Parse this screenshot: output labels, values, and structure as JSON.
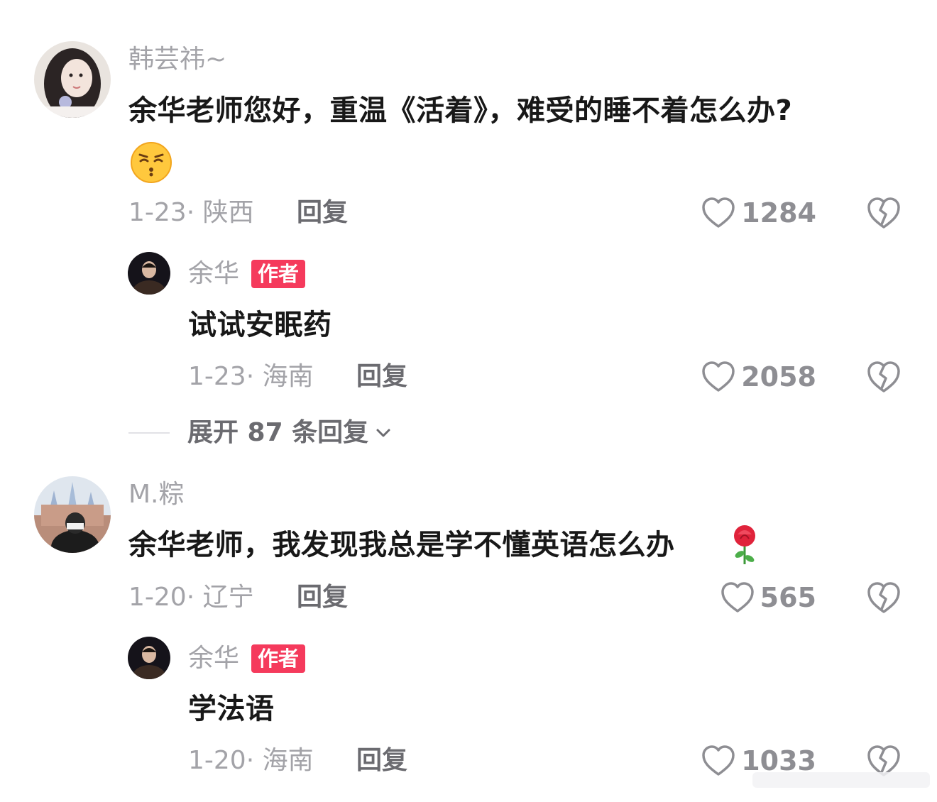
{
  "comments": [
    {
      "username": "韩芸祎~",
      "text": "余华老师您好，重温《活着》，难受的睡不着怎么办?",
      "emoji_name": "sleepless-face-emoji",
      "date_region": "1-23· 陕西",
      "reply_label": "回复",
      "likes": "1284",
      "replies": [
        {
          "username": "余华",
          "badge": "作者",
          "text": "试试安眠药",
          "date_region": "1-23· 海南",
          "reply_label": "回复",
          "likes": "2058"
        }
      ],
      "expand_label": "展开 87 条回复"
    },
    {
      "username": "M.粽",
      "text": "余华老师，我发现我总是学不懂英语怎么办",
      "emoji_name": "rose-emoji",
      "date_region": "1-20· 辽宁",
      "reply_label": "回复",
      "likes": "565",
      "replies": [
        {
          "username": "余华",
          "badge": "作者",
          "text": "学法语",
          "date_region": "1-20· 海南",
          "reply_label": "回复",
          "likes": "1033"
        }
      ]
    }
  ],
  "icons": {
    "like": "heart-outline-icon",
    "dislike": "broken-heart-icon",
    "expand": "chevron-down-icon"
  },
  "colors": {
    "badge": "#f53a5c",
    "muted_text": "#a3a3a8",
    "primary_text": "#181818"
  }
}
